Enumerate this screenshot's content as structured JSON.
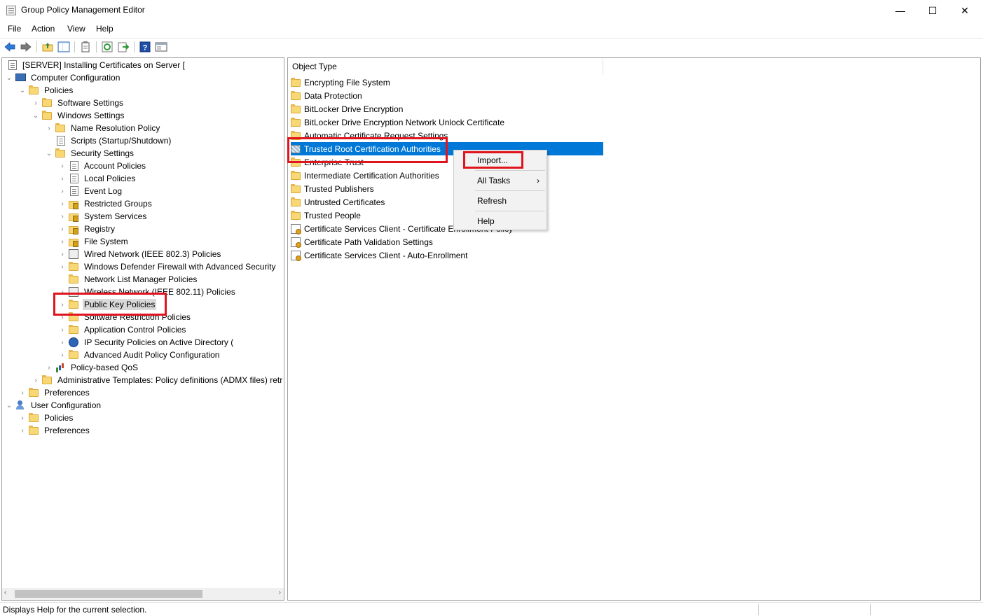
{
  "window": {
    "title": "Group Policy Management Editor",
    "minimize_glyph": "—",
    "maximize_glyph": "☐",
    "close_glyph": "✕"
  },
  "menubar": [
    "File",
    "Action",
    "View",
    "Help"
  ],
  "toolbar": {
    "icons": [
      "back-arrow-icon",
      "forward-arrow-icon",
      "up-folder-icon",
      "show-hide-tree-icon",
      "properties-icon",
      "refresh-icon",
      "export-list-icon",
      "help-icon",
      "console-view-icon"
    ],
    "help_glyph": "?"
  },
  "tree": {
    "items": [
      {
        "label": "[SERVER] Installing Certificates on Server [",
        "icon": "policy-doc-icon",
        "arrow": ""
      },
      {
        "label": "Computer Configuration",
        "icon": "computer-icon",
        "arrow": "⌄"
      },
      {
        "label": "Policies",
        "icon": "folder-icon",
        "arrow": "⌄"
      },
      {
        "label": "Software Settings",
        "icon": "folder-icon",
        "arrow": "›"
      },
      {
        "label": "Windows Settings",
        "icon": "folder-icon",
        "arrow": "⌄"
      },
      {
        "label": "Name Resolution Policy",
        "icon": "folder-icon",
        "arrow": "›"
      },
      {
        "label": "Scripts (Startup/Shutdown)",
        "icon": "script-icon",
        "arrow": ""
      },
      {
        "label": "Security Settings",
        "icon": "folder-icon",
        "arrow": "⌄"
      },
      {
        "label": "Account Policies",
        "icon": "policy-doc-icon",
        "arrow": "›"
      },
      {
        "label": "Local Policies",
        "icon": "policy-doc-icon",
        "arrow": "›"
      },
      {
        "label": "Event Log",
        "icon": "policy-doc-icon",
        "arrow": "›"
      },
      {
        "label": "Restricted Groups",
        "icon": "locked-folder-icon",
        "arrow": "›"
      },
      {
        "label": "System Services",
        "icon": "locked-folder-icon",
        "arrow": "›"
      },
      {
        "label": "Registry",
        "icon": "locked-folder-icon",
        "arrow": "›"
      },
      {
        "label": "File System",
        "icon": "locked-folder-icon",
        "arrow": "›"
      },
      {
        "label": "Wired Network (IEEE 802.3) Policies",
        "icon": "network-icon",
        "arrow": "›"
      },
      {
        "label": "Windows Defender Firewall with Advanced Security",
        "icon": "folder-icon",
        "arrow": "›"
      },
      {
        "label": "Network List Manager Policies",
        "icon": "folder-icon",
        "arrow": ""
      },
      {
        "label": "Wireless Network (IEEE 802.11) Policies",
        "icon": "network-icon",
        "arrow": "›"
      },
      {
        "label": "Public Key Policies",
        "icon": "folder-icon",
        "arrow": "›"
      },
      {
        "label": "Software Restriction Policies",
        "icon": "folder-icon",
        "arrow": "›"
      },
      {
        "label": "Application Control Policies",
        "icon": "folder-icon",
        "arrow": "›"
      },
      {
        "label": "IP Security Policies on Active Directory (",
        "icon": "ip-security-icon",
        "arrow": "›"
      },
      {
        "label": "Advanced Audit Policy Configuration",
        "icon": "folder-icon",
        "arrow": "›"
      },
      {
        "label": "Policy-based QoS",
        "icon": "qos-chart-icon",
        "arrow": "›"
      },
      {
        "label": "Administrative Templates: Policy definitions (ADMX files) retr",
        "icon": "folder-icon",
        "arrow": "›"
      },
      {
        "label": "Preferences",
        "icon": "folder-icon",
        "arrow": "›"
      },
      {
        "label": "User Configuration",
        "icon": "user-icon",
        "arrow": "⌄"
      },
      {
        "label": "Policies",
        "icon": "folder-icon",
        "arrow": "›"
      },
      {
        "label": "Preferences",
        "icon": "folder-icon",
        "arrow": "›"
      }
    ],
    "scroll_left": "‹",
    "scroll_right": "›"
  },
  "list": {
    "column_header": "Object Type",
    "items": [
      {
        "label": "Encrypting File System",
        "icon": "folder-icon"
      },
      {
        "label": "Data Protection",
        "icon": "folder-icon"
      },
      {
        "label": "BitLocker Drive Encryption",
        "icon": "folder-icon"
      },
      {
        "label": "BitLocker Drive Encryption Network Unlock Certificate",
        "icon": "folder-icon"
      },
      {
        "label": "Automatic Certificate Request Settings",
        "icon": "folder-icon"
      },
      {
        "label": "Trusted Root Certification Authorities",
        "icon": "certificate-store-icon"
      },
      {
        "label": "Enterprise Trust",
        "icon": "folder-icon"
      },
      {
        "label": "Intermediate Certification Authorities",
        "icon": "folder-icon"
      },
      {
        "label": "Trusted Publishers",
        "icon": "folder-icon"
      },
      {
        "label": "Untrusted Certificates",
        "icon": "folder-icon"
      },
      {
        "label": "Trusted People",
        "icon": "folder-icon"
      },
      {
        "label": "Certificate Services Client - Certificate Enrollment Policy",
        "icon": "certificate-icon"
      },
      {
        "label": "Certificate Path Validation Settings",
        "icon": "certificate-icon"
      },
      {
        "label": "Certificate Services Client - Auto-Enrollment",
        "icon": "certificate-icon"
      }
    ]
  },
  "context_menu": {
    "items": [
      "Import...",
      "All Tasks",
      "Refresh",
      "Help"
    ],
    "submenu_arrow": "›"
  },
  "status": {
    "text": "Displays Help for the current selection."
  },
  "colors": {
    "selection": "#0078d7",
    "highlight_callout": "#e0141e"
  }
}
